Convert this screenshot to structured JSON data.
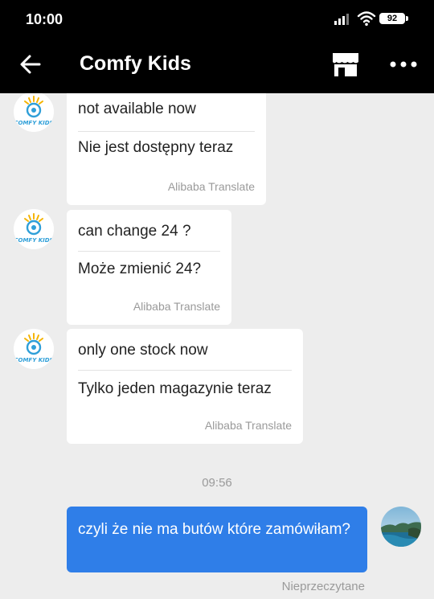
{
  "status_bar": {
    "time": "10:00",
    "battery": "92"
  },
  "header": {
    "title": "Comfy Kids"
  },
  "shop_avatar_text": "COMFY KIDS",
  "messages": [
    {
      "original": "not available now",
      "translation": "Nie jest dostępny teraz",
      "credit": "Alibaba Translate"
    },
    {
      "original": "can change 24 ?",
      "translation": "Może zmienić 24?",
      "credit": "Alibaba Translate"
    },
    {
      "original": "only one stock now",
      "translation": "Tylko jeden magazynie teraz",
      "credit": "Alibaba Translate"
    }
  ],
  "timestamp": "09:56",
  "my_message": {
    "text": "czyli że nie ma butów które zamówiłam?",
    "status": "Nieprzeczytane"
  },
  "colors": {
    "bar": "#000000",
    "background": "#ededed",
    "my_bubble": "#2f7ee8",
    "brand_blue": "#2f9fd8",
    "brand_yellow": "#f5b400"
  }
}
